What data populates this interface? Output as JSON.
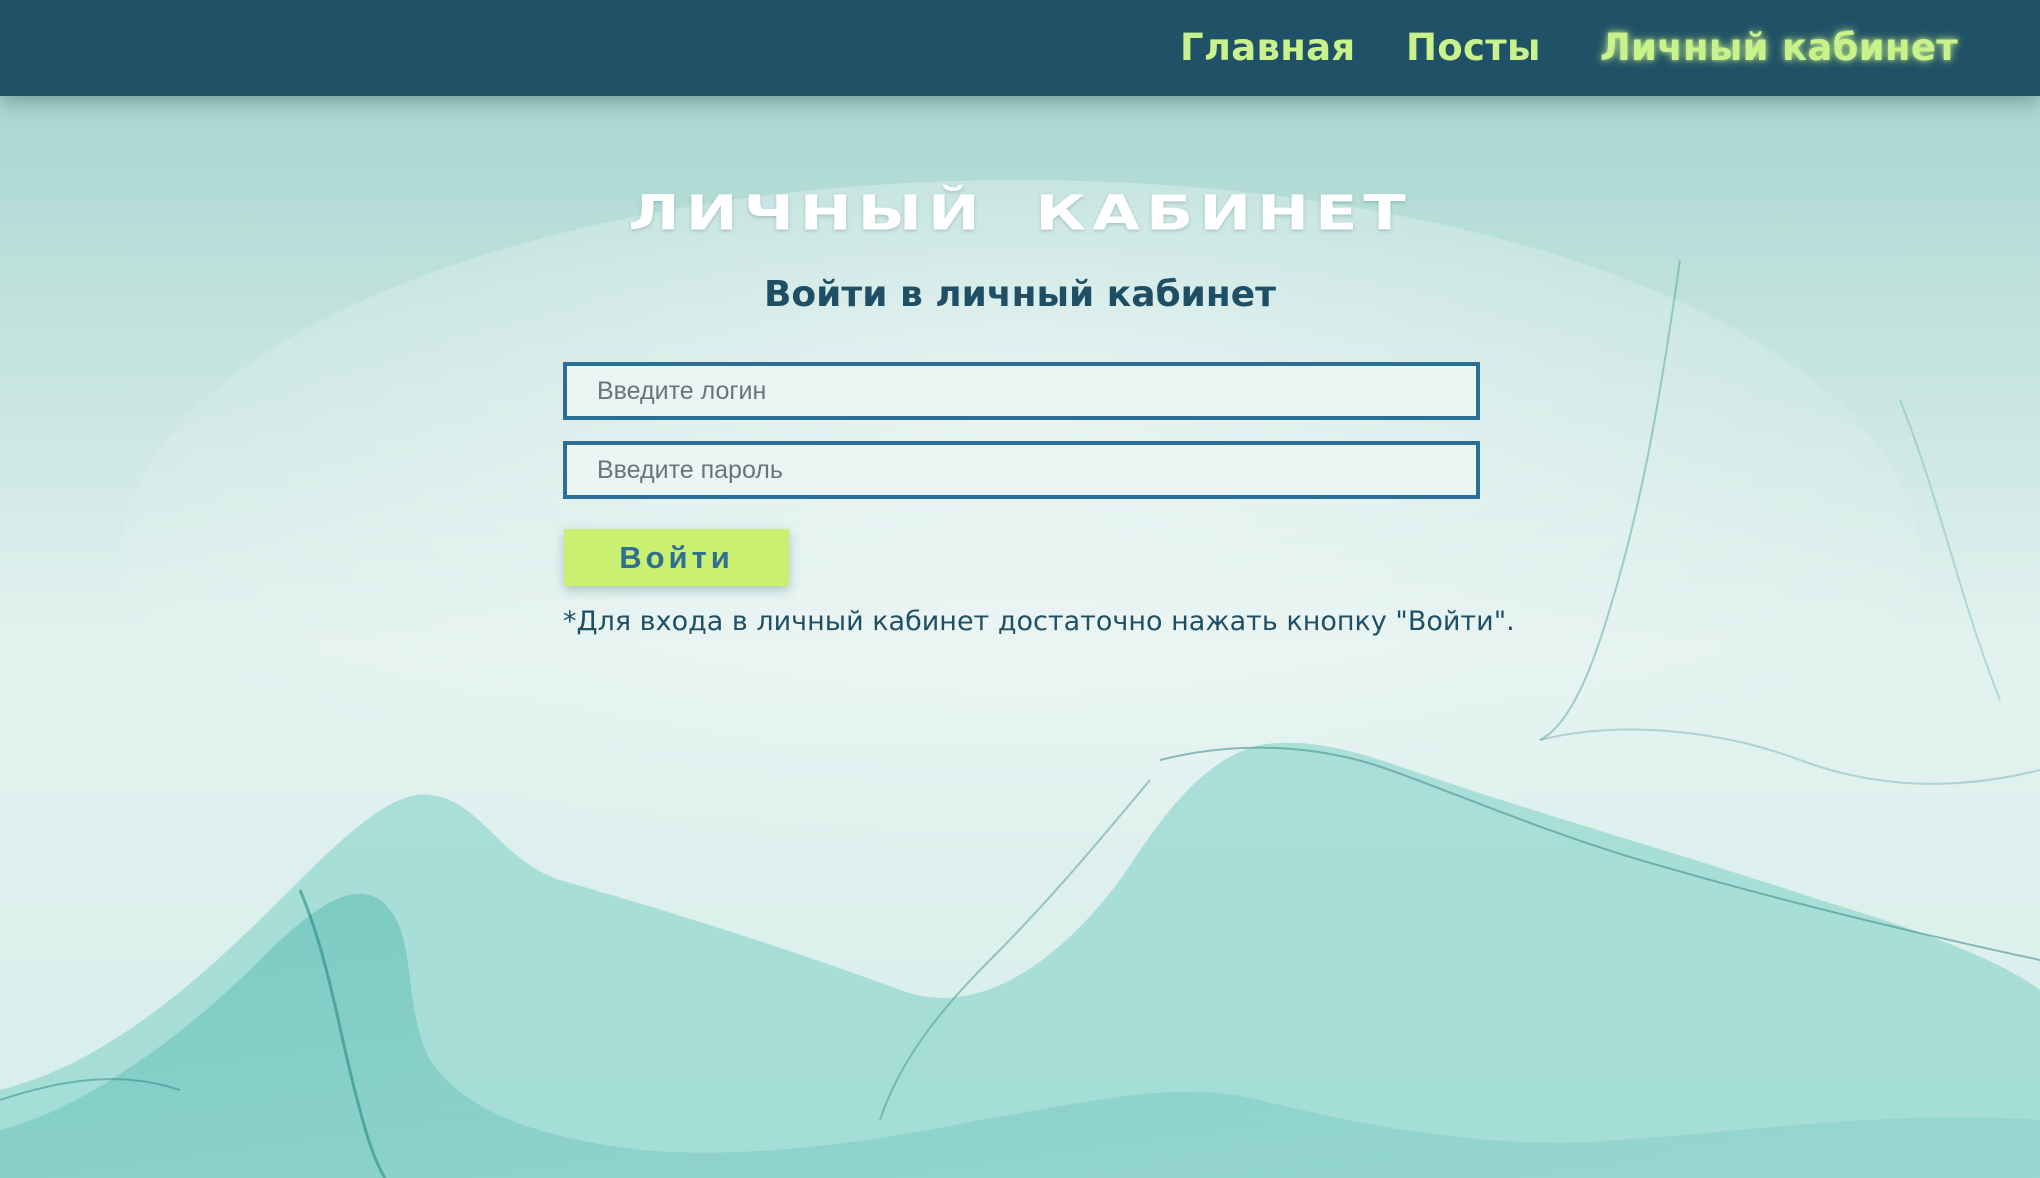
{
  "nav": {
    "items": [
      {
        "label": "Главная"
      },
      {
        "label": "Посты"
      },
      {
        "label": "Личный кабинет",
        "active": true
      }
    ]
  },
  "page": {
    "title": "Личный кабинет",
    "subtitle": "Войти в личный кабинет"
  },
  "form": {
    "login": {
      "placeholder": "Введите логин",
      "value": ""
    },
    "password": {
      "placeholder": "Введите пароль",
      "value": ""
    },
    "submit_label": "Войти",
    "note": "*Для входа в личный кабинет достаточно нажать кнопку \"Войти\"."
  },
  "colors": {
    "header_bg": "#1f5167",
    "nav_text": "#c9f28c",
    "accent_button": "#c9f071",
    "dark_text": "#1f4f64",
    "field_border": "#2c6f96"
  }
}
